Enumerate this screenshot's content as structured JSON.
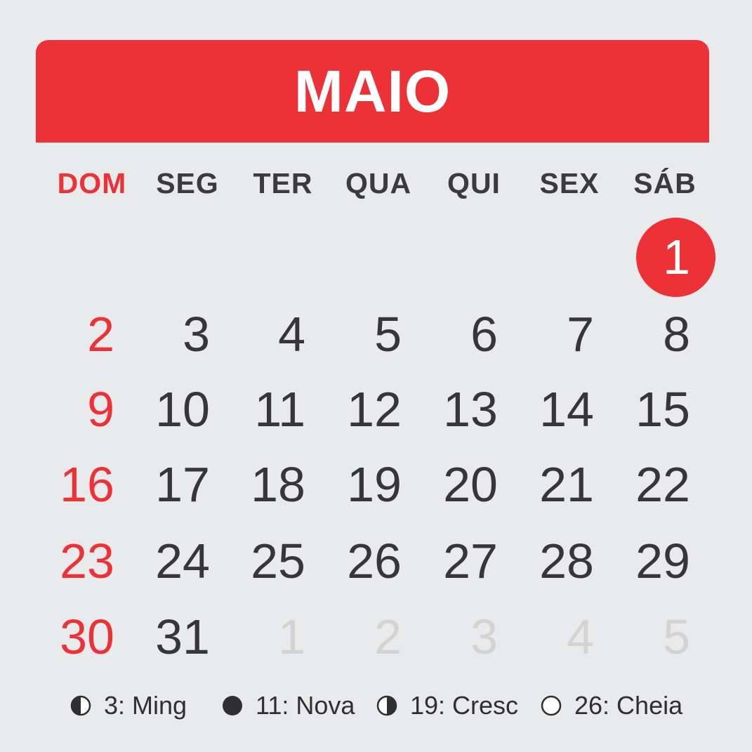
{
  "month": "MAIO",
  "weekdays": [
    "DOM",
    "SEG",
    "TER",
    "QUA",
    "QUI",
    "SEX",
    "SÁB"
  ],
  "days": {
    "d1": "1",
    "d2": "2",
    "d3": "3",
    "d4": "4",
    "d5": "5",
    "d6": "6",
    "d7": "7",
    "d8": "8",
    "d9": "9",
    "d10": "10",
    "d11": "11",
    "d12": "12",
    "d13": "13",
    "d14": "14",
    "d15": "15",
    "d16": "16",
    "d17": "17",
    "d18": "18",
    "d19": "19",
    "d20": "20",
    "d21": "21",
    "d22": "22",
    "d23": "23",
    "d24": "24",
    "d25": "25",
    "d26": "26",
    "d27": "27",
    "d28": "28",
    "d29": "29",
    "d30": "30",
    "d31": "31",
    "n1": "1",
    "n2": "2",
    "n3": "3",
    "n4": "4",
    "n5": "5"
  },
  "moon_phases": [
    {
      "label": "3: Ming",
      "icon": "waning-moon-icon"
    },
    {
      "label": "11: Nova",
      "icon": "new-moon-icon"
    },
    {
      "label": "19: Cresc",
      "icon": "waxing-moon-icon"
    },
    {
      "label": "26: Cheia",
      "icon": "full-moon-icon"
    }
  ],
  "colors": {
    "accent": "#ec3237",
    "background": "#e9eaeb",
    "text": "#363537",
    "muted": "#d3d3d3"
  }
}
